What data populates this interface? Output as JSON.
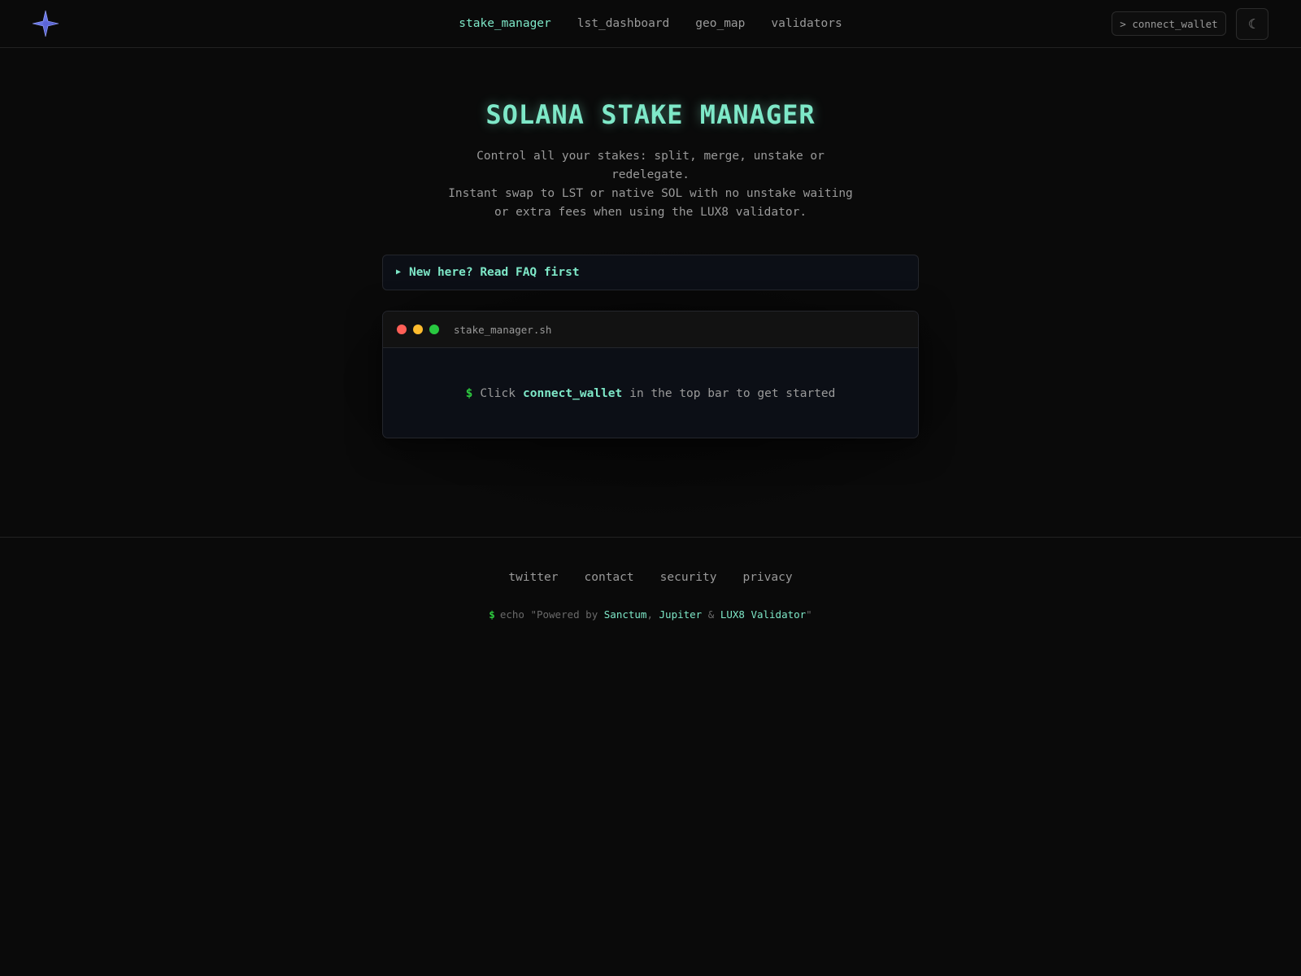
{
  "header": {
    "logo_icon": "star-logo-icon",
    "nav": [
      {
        "label": "stake_manager",
        "active": true
      },
      {
        "label": "lst_dashboard",
        "active": false
      },
      {
        "label": "geo_map",
        "active": false
      },
      {
        "label": "validators",
        "active": false
      }
    ],
    "connect_label": "> connect_wallet",
    "theme_icon": "☾"
  },
  "hero": {
    "title": "SOLANA STAKE MANAGER",
    "subtitle_lines": [
      "Control all your stakes: split, merge, unstake or",
      "redelegate.",
      "Instant swap to LST or native SOL with no unstake waiting",
      "or extra fees when using the LUX8 validator."
    ]
  },
  "faq": {
    "arrow": "▶",
    "label": "New here? Read FAQ first"
  },
  "terminal": {
    "title": "stake_manager.sh",
    "prompt": "$",
    "text_before": "Click",
    "highlight": "connect_wallet",
    "text_after": "in the top bar to get started"
  },
  "footer": {
    "links": [
      "twitter",
      "contact",
      "security",
      "privacy"
    ],
    "echo": {
      "prompt": "$",
      "prefix": "echo \"Powered by",
      "partners": [
        "Sanctum",
        "Jupiter",
        "LUX8 Validator"
      ],
      "sep1": ",",
      "sep2": "&",
      "suffix": "\""
    }
  },
  "colors": {
    "background": "#0a0a0a",
    "accent": "#7ee8c8",
    "prompt_green": "#2ecc40",
    "muted": "#9a9a9a"
  }
}
